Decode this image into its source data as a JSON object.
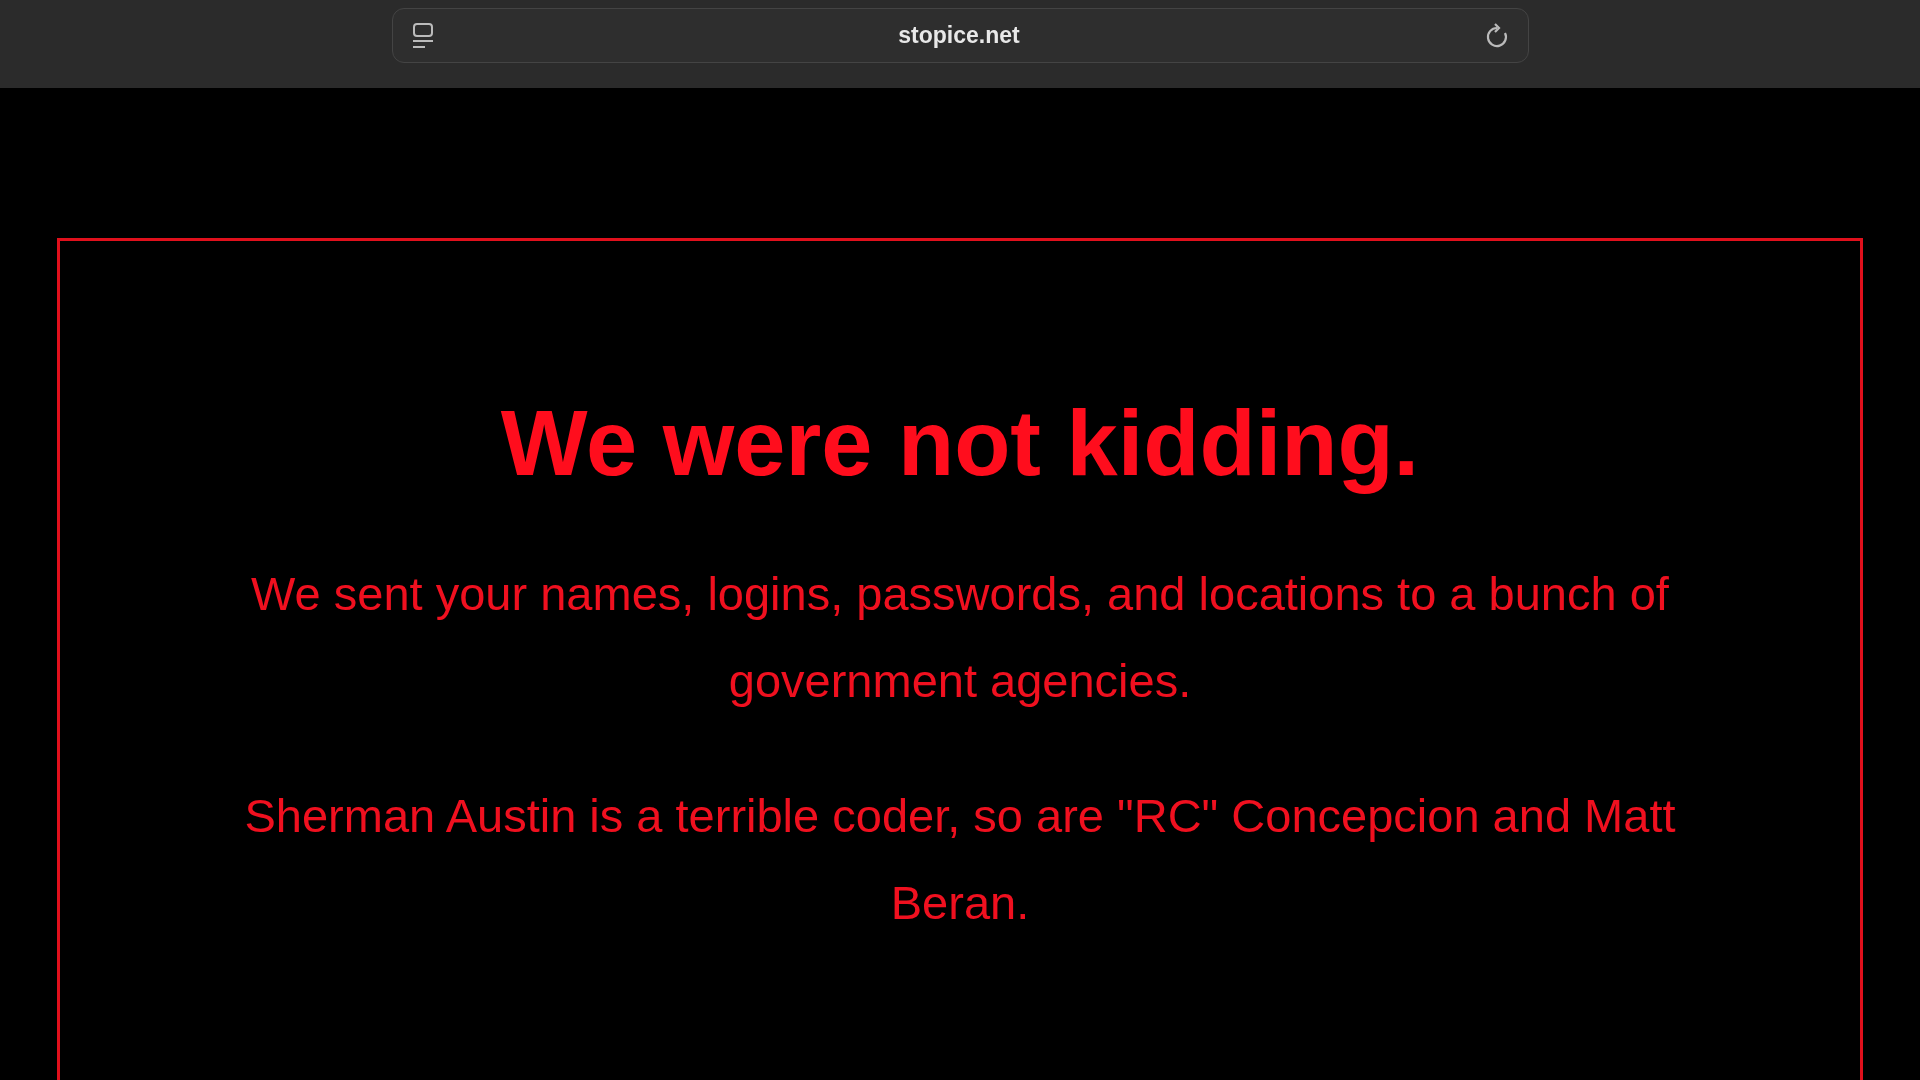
{
  "browser": {
    "url": "stopice.net"
  },
  "message": {
    "heading": "We were not kidding.",
    "paragraphs": [
      "We sent your names, logins, passwords, and locations to a bunch of government agencies.",
      "Sherman Austin is a terrible coder, so are \"RC\" Concepcion and Matt Beran."
    ]
  }
}
